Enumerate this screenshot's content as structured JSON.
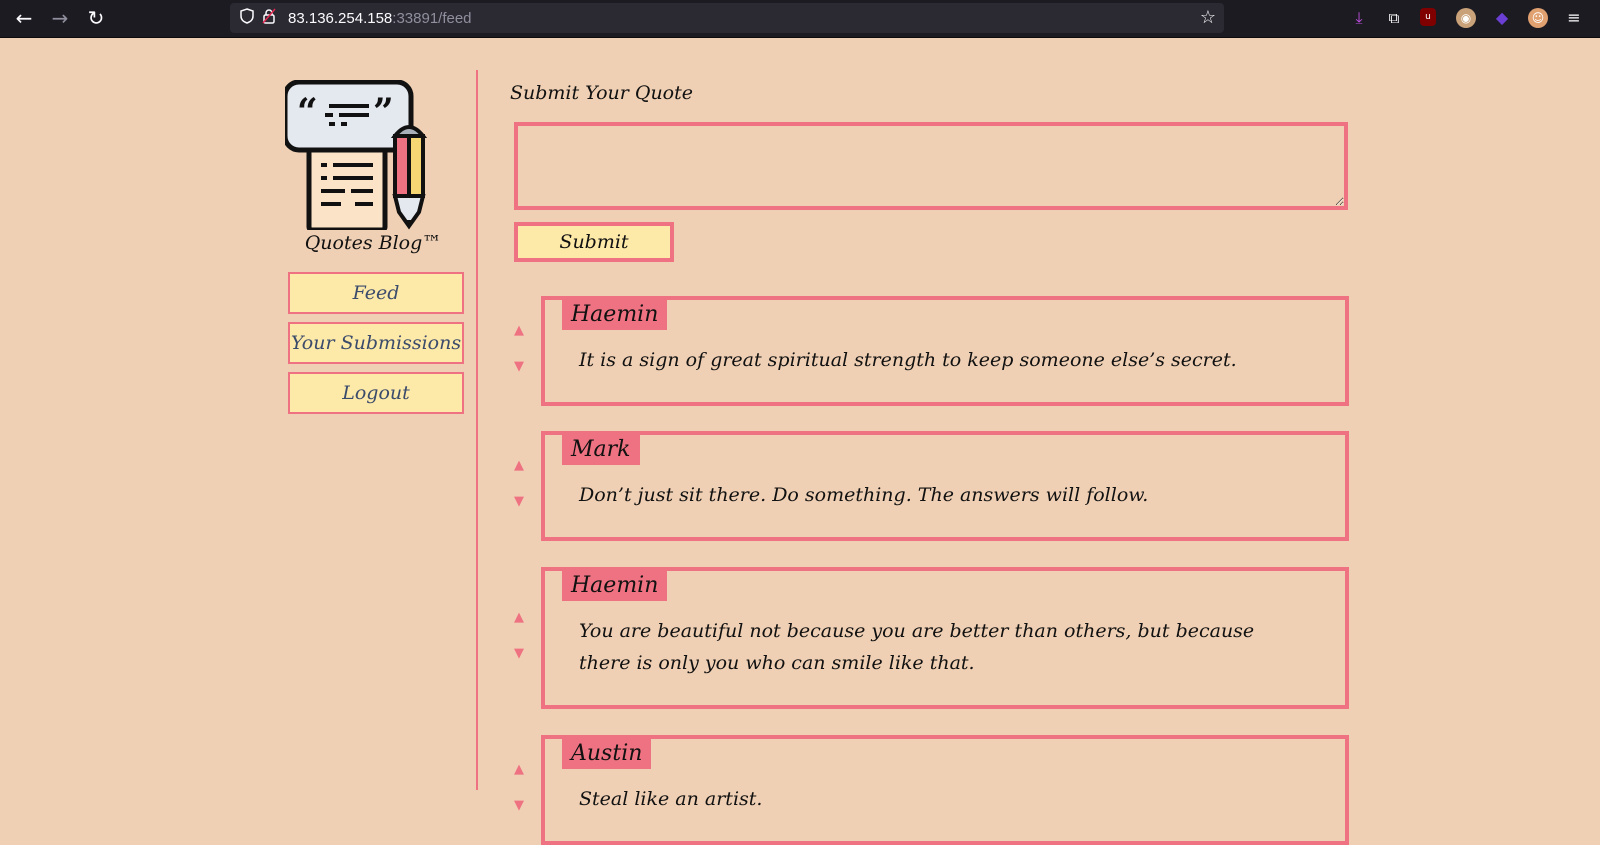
{
  "browser": {
    "url_host": "83.136.254.158",
    "url_rest": ":33891/feed",
    "icons": [
      "back-arrow-icon",
      "forward-arrow-icon",
      "reload-icon",
      "shield-icon",
      "lock-icon",
      "star-icon",
      "download-icon",
      "extensions-icon",
      "ublock-icon",
      "privacy-badger-icon",
      "dark-extension-icon",
      "profile-icon",
      "menu-icon"
    ]
  },
  "sidebar": {
    "brand": "Quotes Blog™",
    "menu": [
      {
        "label": "Feed"
      },
      {
        "label": "Your Submissions"
      },
      {
        "label": "Logout"
      }
    ]
  },
  "form": {
    "title": "Submit Your Quote",
    "input_value": "",
    "submit_label": "Submit"
  },
  "feed": {
    "posts": [
      {
        "author": "Haemin",
        "quote": "It is a sign of great spiritual strength to keep someone else’s secret."
      },
      {
        "author": "Mark",
        "quote": "Don’t just sit there. Do something. The answers will follow."
      },
      {
        "author": "Haemin",
        "quote": "You are beautiful not because you are better than others, but because there is only you who can smile like that."
      },
      {
        "author": "Austin",
        "quote": "Steal like an artist."
      }
    ],
    "upvote_glyph": "▲",
    "downvote_glyph": "▼"
  },
  "colors": {
    "background": "#f0d0b4",
    "accent": "#ee7281",
    "button_fill": "#fde9a8"
  }
}
